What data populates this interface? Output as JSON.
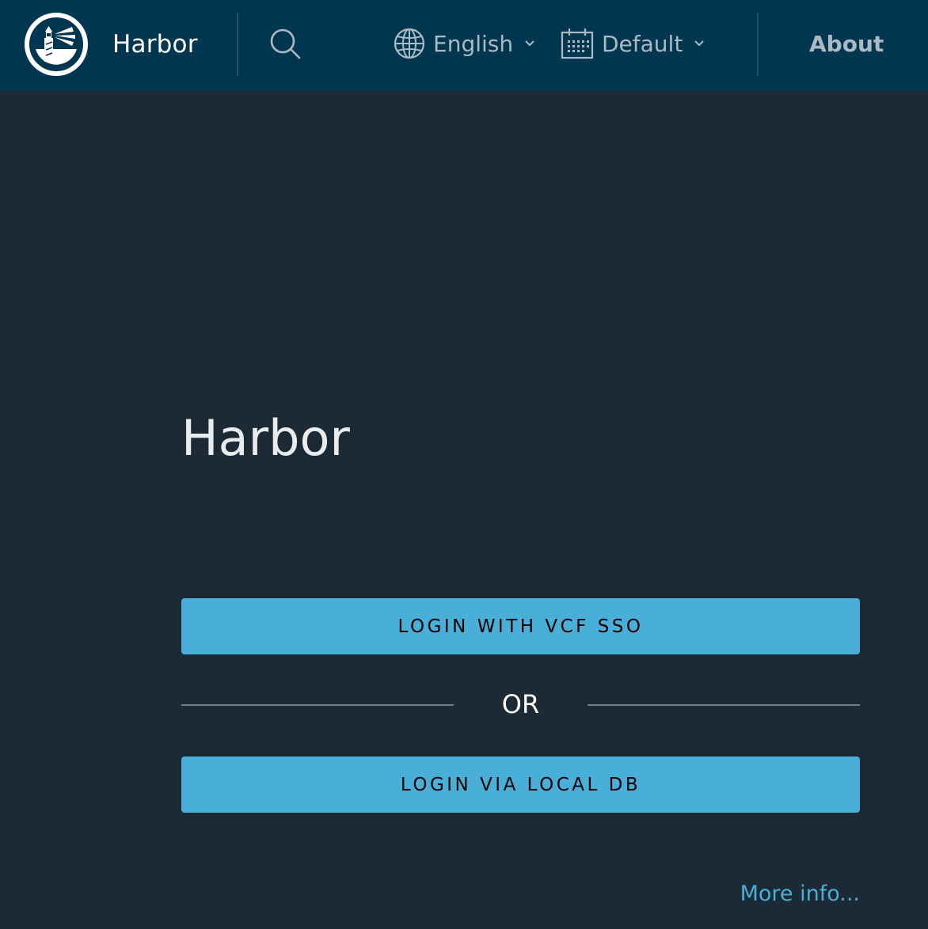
{
  "header": {
    "brand": "Harbor",
    "language_label": "English",
    "theme_label": "Default",
    "about_label": "About"
  },
  "main": {
    "title": "Harbor",
    "sso_button_label": "LOGIN WITH VCF SSO",
    "or_label": "OR",
    "local_button_label": "LOGIN VIA LOCAL DB",
    "more_info_label": "More info..."
  },
  "icons": {
    "logo": "harbor-lighthouse-logo",
    "search": "search-icon",
    "language": "globe-icon",
    "theme": "calendar-icon",
    "dropdown": "chevron-down-icon"
  },
  "colors": {
    "header_bg": "#003650",
    "page_bg": "#1b2a35",
    "button_bg": "#49afd9",
    "link": "#49afd9",
    "nav_text": "#acbac3"
  }
}
